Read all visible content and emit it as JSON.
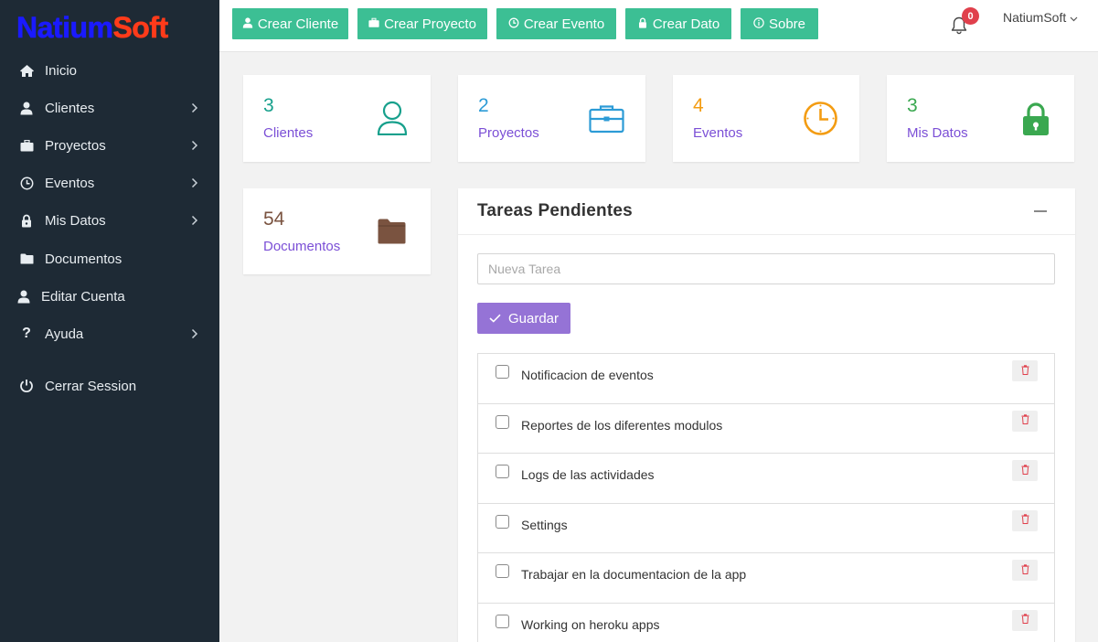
{
  "logo": {
    "part1": "Natium",
    "part2": "Soft"
  },
  "sidebar": {
    "items": [
      {
        "label": "Inicio",
        "icon": "home-icon",
        "has_submenu": false
      },
      {
        "label": "Clientes",
        "icon": "user-icon",
        "has_submenu": true
      },
      {
        "label": "Proyectos",
        "icon": "briefcase-icon",
        "has_submenu": true
      },
      {
        "label": "Eventos",
        "icon": "clock-icon",
        "has_submenu": true
      },
      {
        "label": "Mis Datos",
        "icon": "lock-icon",
        "has_submenu": true
      },
      {
        "label": "Documentos",
        "icon": "folder-icon",
        "has_submenu": false
      },
      {
        "label": "Editar Cuenta",
        "icon": "user-icon",
        "has_submenu": false
      },
      {
        "label": "Ayuda",
        "icon": "question-icon",
        "has_submenu": true
      },
      {
        "label": "Cerrar Session",
        "icon": "power-icon",
        "has_submenu": false
      }
    ]
  },
  "topbar": {
    "buttons": [
      {
        "label": "Crear Cliente",
        "icon": "user-icon"
      },
      {
        "label": "Crear Proyecto",
        "icon": "briefcase-icon"
      },
      {
        "label": "Crear Evento",
        "icon": "clock-icon"
      },
      {
        "label": "Crear Dato",
        "icon": "lock-icon"
      },
      {
        "label": "Sobre",
        "icon": "info-icon"
      }
    ],
    "notifications_count": "0",
    "username": "NatiumSoft"
  },
  "stats": [
    {
      "value": "3",
      "label": "Clientes",
      "icon": "user-icon",
      "color": "#17a08c"
    },
    {
      "value": "2",
      "label": "Proyectos",
      "icon": "briefcase-icon",
      "color": "#2c9bd6"
    },
    {
      "value": "4",
      "label": "Eventos",
      "icon": "clock-icon",
      "color": "#f39c12"
    },
    {
      "value": "3",
      "label": "Mis Datos",
      "icon": "lock-icon",
      "color": "#3aa850"
    },
    {
      "value": "54",
      "label": "Documentos",
      "icon": "folder-icon",
      "color": "#7a5340"
    }
  ],
  "tasks": {
    "title": "Tareas Pendientes",
    "input_placeholder": "Nueva Tarea",
    "save_label": "Guardar",
    "items": [
      "Notificacion de eventos",
      "Reportes de los diferentes modulos",
      "Logs de las actividades",
      "Settings",
      "Trabajar en la documentacion de la app",
      "Working on heroku apps"
    ]
  },
  "colors": {
    "sidebar_bg": "#1e2a35",
    "topbar_button": "#3cbf94",
    "save_button": "#9573d6",
    "label_purple": "#7b4fd6",
    "delete_red": "#e0404c"
  }
}
